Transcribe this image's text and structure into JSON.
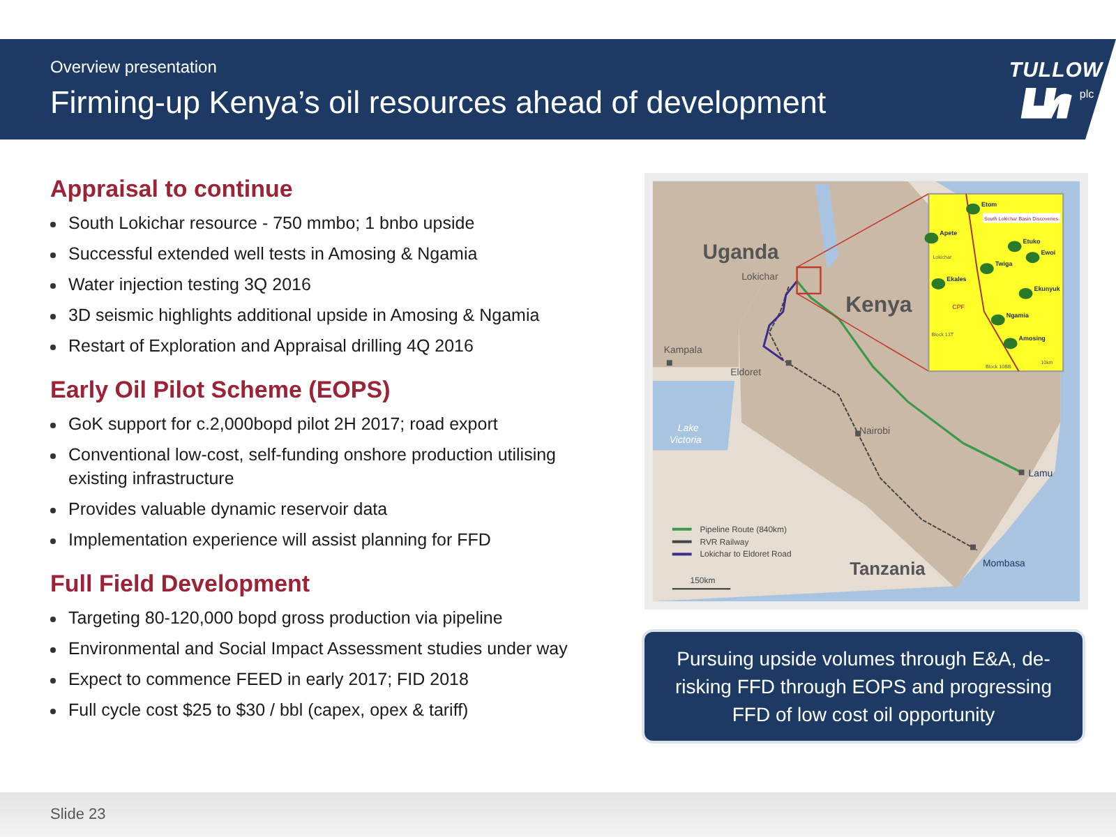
{
  "header": {
    "subtitle": "Overview presentation",
    "title": "Firming-up Kenya’s oil resources ahead of development",
    "logo_text": "TULLOW",
    "logo_suffix": "plc"
  },
  "sections": [
    {
      "heading": "Appraisal to continue",
      "bullets": [
        "South Lokichar resource - 750 mmbo; 1 bnbo upside",
        "Successful extended well tests in Amosing & Ngamia",
        "Water injection testing 3Q 2016",
        "3D seismic highlights additional upside in Amosing & Ngamia",
        "Restart of Exploration and Appraisal drilling 4Q 2016"
      ]
    },
    {
      "heading": "Early Oil Pilot Scheme (EOPS)",
      "bullets": [
        "GoK support for c.2,000bopd pilot 2H 2017; road export",
        "Conventional low-cost, self-funding onshore production utilising existing infrastructure",
        "Provides valuable dynamic reservoir data",
        "Implementation experience will assist planning for FFD"
      ]
    },
    {
      "heading": "Full Field Development",
      "bullets": [
        "Targeting 80-120,000 bopd gross production via pipeline",
        "Environmental and Social Impact Assessment studies under way",
        "Expect to commence FEED in early 2017; FID 2018",
        "Full cycle cost $25 to $30 / bbl (capex, opex & tariff)"
      ]
    }
  ],
  "map": {
    "labels": [
      {
        "text": "Uganda",
        "kind": "country"
      },
      {
        "text": "Kenya",
        "kind": "country"
      },
      {
        "text": "Tanzania",
        "kind": "country"
      },
      {
        "text": "Lokichar",
        "kind": "town"
      },
      {
        "text": "Kampala",
        "kind": "town"
      },
      {
        "text": "Eldoret",
        "kind": "town"
      },
      {
        "text": "Nairobi",
        "kind": "town"
      },
      {
        "text": "Lamu",
        "kind": "coast"
      },
      {
        "text": "Mombasa",
        "kind": "coast"
      },
      {
        "text": "Lake",
        "kind": "lake"
      },
      {
        "text": "Victoria",
        "kind": "lake"
      }
    ],
    "legend": [
      {
        "text": "Pipeline Route (840km)",
        "color": "#3a9a4a"
      },
      {
        "text": "RVR Railway",
        "color": "#444444"
      },
      {
        "text": "Lokichar to Eldoret Road",
        "color": "#3b2d8f"
      }
    ],
    "scale": "150km",
    "inset": {
      "title": "South Lokichar Basin Discoveries",
      "fields": [
        "Etom",
        "Apete",
        "Twiga",
        "Ekales",
        "Etuko",
        "Ewoi",
        "Ekunyuk",
        "Ngamia",
        "Amosing"
      ],
      "facility": "CPF",
      "town": "Lokichar",
      "blocks": [
        "Block 13T",
        "Block 10BB"
      ],
      "scale": "10km"
    }
  },
  "callout": "Pursuing upside volumes through E&A, de-risking FFD through EOPS and progressing FFD of low cost oil opportunity",
  "footer": "Slide 23"
}
